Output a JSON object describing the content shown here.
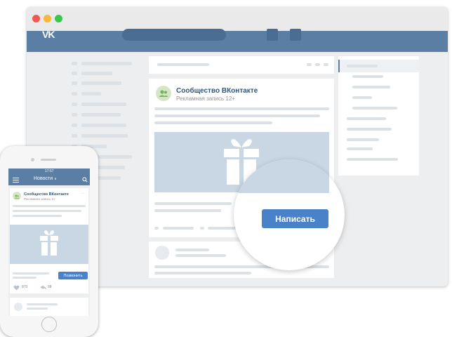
{
  "desktop": {
    "logo": "VK",
    "post": {
      "author": "Сообщество ВКонтакте",
      "subtitle": "Рекламная запись 12+",
      "button_label": "Написать"
    }
  },
  "mobile": {
    "status_time": "17:57",
    "nav_title": "Новости",
    "post": {
      "author": "Сообщество ВКонтакте",
      "subtitle": "Рекламная запись 0+",
      "button_label": "Позвонить",
      "likes": "870",
      "shares": "98"
    }
  },
  "icons": [
    "vk-logo-icon",
    "community-icon",
    "gift-icon",
    "menu-icon",
    "search-icon",
    "like-icon",
    "share-icon",
    "more-icon"
  ],
  "colors": {
    "vk_header": "#5b7ea4",
    "button": "#4a82c9",
    "link": "#2a5885",
    "placeholder": "#c9d6e3"
  }
}
